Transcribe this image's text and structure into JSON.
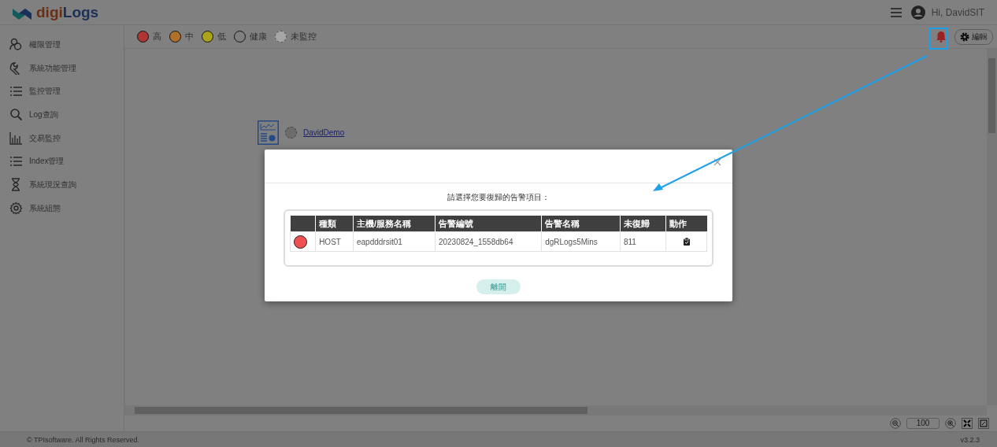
{
  "header": {
    "logo_text_1": "digi",
    "logo_text_2": "Logs",
    "greeting": "Hi, DavidSIT"
  },
  "sidebar": {
    "items": [
      {
        "label": "權限管理"
      },
      {
        "label": "系統功能管理"
      },
      {
        "label": "監控管理"
      },
      {
        "label": "Log查詢"
      },
      {
        "label": "交易監控"
      },
      {
        "label": "Index管理"
      },
      {
        "label": "系統現況查詢"
      },
      {
        "label": "系統組態"
      }
    ]
  },
  "legend": {
    "items": [
      {
        "label": "高",
        "kind": "filled",
        "color": "#b03535"
      },
      {
        "label": "中",
        "kind": "filled",
        "color": "#b0702a"
      },
      {
        "label": "低",
        "kind": "filled",
        "color": "#aca21c"
      },
      {
        "label": "健康",
        "kind": "outline",
        "color": "#808080"
      },
      {
        "label": "未監控",
        "kind": "dashed",
        "color": "#a6a6a6"
      }
    ]
  },
  "edit_button": "編輯",
  "canvas": {
    "nodes": [
      {
        "label": "DavidDemo"
      }
    ]
  },
  "zoom": {
    "value": "100"
  },
  "footer": {
    "copyright": "© TPIsoftware. All Rights Reserved.",
    "version": "v3.2.3"
  },
  "modal": {
    "prompt": "請選擇您要復歸的告警項目：",
    "table": {
      "columns": [
        "",
        "種類",
        "主機/服務名稱",
        "告警編號",
        "告警名稱",
        "未復歸",
        "動作"
      ],
      "rows": [
        {
          "color": "#f05050",
          "cells": [
            "",
            "HOST",
            "eapdddrsit01",
            "20230824_1558db64",
            "dgRLogs5Mins",
            "811"
          ]
        }
      ]
    },
    "close_button": "離開"
  }
}
